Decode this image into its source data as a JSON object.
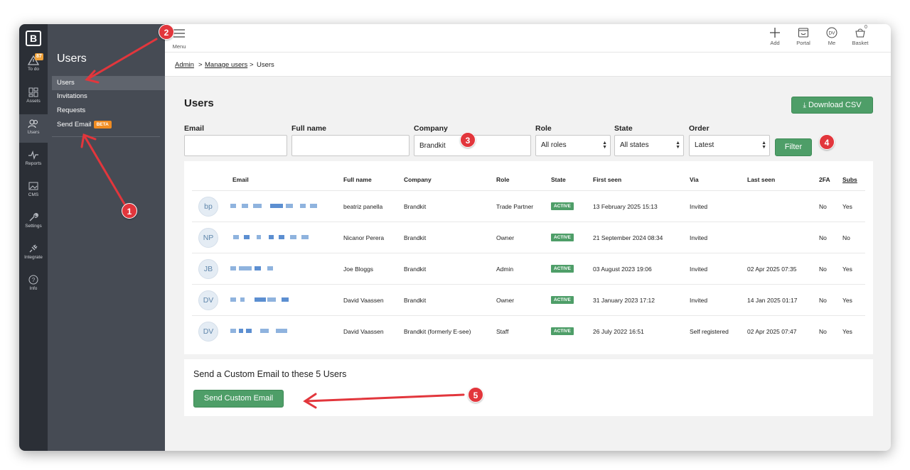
{
  "rail": {
    "items": [
      {
        "label": "To do",
        "badge": "87"
      },
      {
        "label": "Assets"
      },
      {
        "label": "Users"
      },
      {
        "label": "Reports"
      },
      {
        "label": "CMS"
      },
      {
        "label": "Settings"
      },
      {
        "label": "Integrate"
      },
      {
        "label": "Info"
      }
    ]
  },
  "subnav": {
    "title": "Users",
    "items": [
      {
        "label": "Users"
      },
      {
        "label": "Invitations"
      },
      {
        "label": "Requests"
      },
      {
        "label": "Send Email",
        "badge": "BETA"
      }
    ]
  },
  "topbar": {
    "menu_label": "Menu",
    "actions": [
      {
        "label": "Add",
        "icon": "plus-icon"
      },
      {
        "label": "Portal",
        "icon": "portal-icon"
      },
      {
        "label": "Me",
        "icon": "avatar-icon",
        "initials": "DV"
      },
      {
        "label": "Basket",
        "icon": "basket-icon",
        "count": "0"
      }
    ]
  },
  "breadcrumb": [
    "Admin",
    "Manage users",
    "Users"
  ],
  "page": {
    "title": "Users",
    "download_label": "Download CSV"
  },
  "filters": {
    "email_label": "Email",
    "email_value": "",
    "fullname_label": "Full name",
    "fullname_value": "",
    "company_label": "Company",
    "company_value": "Brandkit",
    "role_label": "Role",
    "role_value": "All roles",
    "state_label": "State",
    "state_value": "All states",
    "order_label": "Order",
    "order_value": "Latest",
    "filter_button": "Filter"
  },
  "table": {
    "headers": [
      "Email",
      "Full name",
      "Company",
      "Role",
      "State",
      "First seen",
      "Via",
      "Last seen",
      "2FA",
      "Subs"
    ],
    "rows": [
      {
        "initials": "bp",
        "name": "beatriz panella",
        "company": "Brandkit",
        "role": "Trade Partner",
        "state": "ACTIVE",
        "first_seen": "13 February 2025 15:13",
        "via": "Invited",
        "last_seen": "",
        "twofa": "No",
        "subs": "Yes"
      },
      {
        "initials": "NP",
        "name": "Nicanor Perera",
        "company": "Brandkit",
        "role": "Owner",
        "state": "ACTIVE",
        "first_seen": "21 September 2024 08:34",
        "via": "Invited",
        "last_seen": "",
        "twofa": "No",
        "subs": "No"
      },
      {
        "initials": "JB",
        "name": "Joe Bloggs",
        "company": "Brandkit",
        "role": "Admin",
        "state": "ACTIVE",
        "first_seen": "03 August 2023 19:06",
        "via": "Invited",
        "last_seen": "02 Apr 2025 07:35",
        "twofa": "No",
        "subs": "Yes"
      },
      {
        "initials": "DV",
        "name": "David Vaassen",
        "company": "Brandkit",
        "role": "Owner",
        "state": "ACTIVE",
        "first_seen": "31 January 2023 17:12",
        "via": "Invited",
        "last_seen": "14 Jan 2025 01:17",
        "twofa": "No",
        "subs": "Yes"
      },
      {
        "initials": "DV",
        "name": "David Vaassen",
        "company": "Brandkit (formerly E-see)",
        "role": "Staff",
        "state": "ACTIVE",
        "first_seen": "26 July 2022 16:51",
        "via": "Self registered",
        "last_seen": "02 Apr 2025 07:47",
        "twofa": "No",
        "subs": "Yes"
      }
    ]
  },
  "email_section": {
    "title": "Send a Custom Email to these 5 Users",
    "button": "Send Custom Email"
  },
  "annotations": [
    "1",
    "2",
    "3",
    "4",
    "5"
  ],
  "colors": {
    "accent_green": "#4e9e68",
    "annotation_red": "#e2363c",
    "rail_bg": "#2b2f36",
    "subnav_bg": "#464b54"
  }
}
